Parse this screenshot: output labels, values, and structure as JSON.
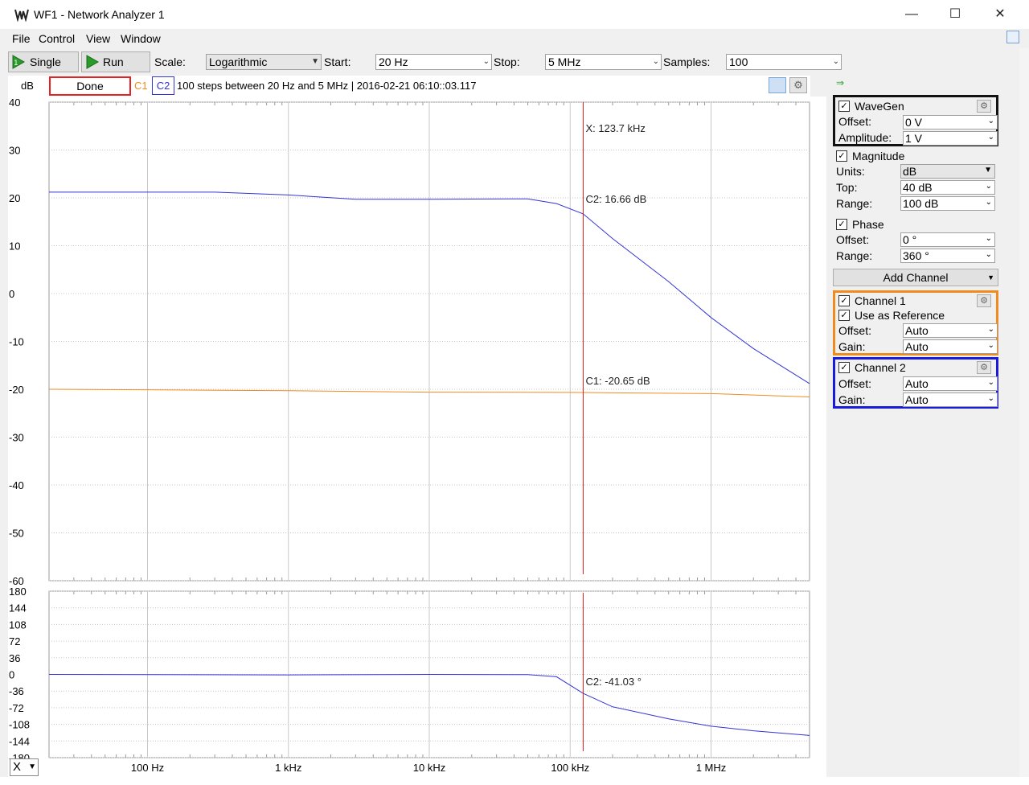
{
  "window": {
    "title": "WF1 - Network Analyzer 1"
  },
  "menu": [
    "File",
    "Control",
    "View",
    "Window"
  ],
  "toolbar": {
    "single_label": "Single",
    "run_label": "Run",
    "scale_label": "Scale:",
    "scale_value": "Logarithmic",
    "start_label": "Start:",
    "start_value": "20 Hz",
    "stop_label": "Stop:",
    "stop_value": "5 MHz",
    "samples_label": "Samples:",
    "samples_value": "100"
  },
  "infobar": {
    "unit": "dB",
    "status": "Done",
    "c1": "C1",
    "c2": "C2",
    "summary": "100 steps  between 20 Hz and 5 MHz | 2016-02-21 06:10::03.117"
  },
  "colors": {
    "c1": "#f08c1e",
    "c2": "#3333d9",
    "cursor": "#d81e1e",
    "status_border": "#e8201f"
  },
  "magnitude_ticks": [
    "40",
    "30",
    "20",
    "10",
    "0",
    "-10",
    "-20",
    "-30",
    "-40",
    "-50",
    "-60"
  ],
  "phase_ticks": [
    "180",
    "144",
    "108",
    "72",
    "36",
    "0",
    "-36",
    "-72",
    "-108",
    "-144",
    "-180"
  ],
  "x_ticks": [
    "100 Hz",
    "1 kHz",
    "10 kHz",
    "100 kHz",
    "1 MHz"
  ],
  "cursor": {
    "x_label": "X: 123.7 kHz",
    "c2_mag": "C2: 16.66 dB",
    "c1_mag": "C1: -20.65 dB",
    "c2_phase": "C2: -41.03 °"
  },
  "x_selector": "X",
  "panel": {
    "wavegen": {
      "label": "WaveGen",
      "offset_label": "Offset:",
      "offset": "0 V",
      "amplitude_label": "Amplitude:",
      "amplitude": "1 V"
    },
    "magnitude": {
      "label": "Magnitude",
      "units_label": "Units:",
      "units": "dB",
      "top_label": "Top:",
      "top": "40 dB",
      "range_label": "Range:",
      "range": "100 dB"
    },
    "phase": {
      "label": "Phase",
      "offset_label": "Offset:",
      "offset": "0 °",
      "range_label": "Range:",
      "range": "360 °"
    },
    "add_channel": "Add Channel",
    "channel1": {
      "label": "Channel 1",
      "ref_label": "Use as Reference",
      "offset_label": "Offset:",
      "offset": "Auto",
      "gain_label": "Gain:",
      "gain": "Auto"
    },
    "channel2": {
      "label": "Channel 2",
      "offset_label": "Offset:",
      "offset": "Auto",
      "gain_label": "Gain:",
      "gain": "Auto"
    }
  },
  "chart_data": [
    {
      "type": "line",
      "xscale": "log",
      "xlim": [
        20,
        5000000
      ],
      "ylim": [
        -60,
        40
      ],
      "ylabel": "dB",
      "series": [
        {
          "name": "C1",
          "x": [
            20,
            100,
            1000,
            10000,
            100000,
            1000000,
            5000000
          ],
          "values": [
            -20.0,
            -20.1,
            -20.3,
            -20.6,
            -20.65,
            -20.9,
            -21.6
          ]
        },
        {
          "name": "C2",
          "x": [
            20,
            300,
            1000,
            3000,
            10000,
            50000,
            80000,
            123700,
            200000,
            500000,
            1000000,
            2000000,
            5000000
          ],
          "values": [
            21.2,
            21.2,
            20.6,
            19.7,
            19.7,
            19.8,
            18.8,
            16.66,
            11.5,
            2.5,
            -5.0,
            -11.5,
            -18.8
          ]
        }
      ]
    },
    {
      "type": "line",
      "xscale": "log",
      "xlim": [
        20,
        5000000
      ],
      "ylim": [
        -180,
        180
      ],
      "series": [
        {
          "name": "C2",
          "x": [
            20,
            1000,
            10000,
            50000,
            80000,
            123700,
            200000,
            500000,
            1000000,
            2000000,
            5000000
          ],
          "values": [
            0,
            -1,
            0,
            -0.5,
            -5,
            -41.03,
            -70,
            -96,
            -112,
            -122,
            -132
          ]
        }
      ]
    }
  ]
}
